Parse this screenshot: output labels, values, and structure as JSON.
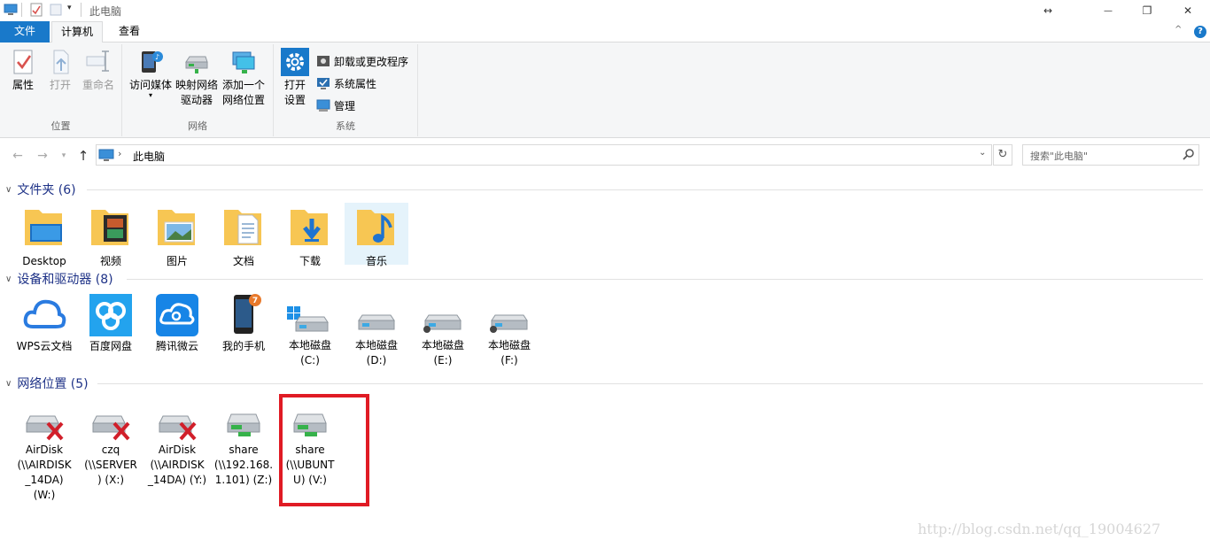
{
  "window": {
    "title": "此电脑",
    "controls": {
      "resize": "↔",
      "minimize": "—",
      "restore": "❐",
      "close": "✕"
    }
  },
  "tabs": [
    {
      "label": "文件"
    },
    {
      "label": "计算机"
    },
    {
      "label": "查看"
    }
  ],
  "help": "?",
  "collapse": "^",
  "ribbon": {
    "location": {
      "label": "位置",
      "properties": "属性",
      "open": "打开",
      "rename": "重命名"
    },
    "network": {
      "label": "网络",
      "media": "访问媒体",
      "map_drive_1": "映射网络",
      "map_drive_2": "驱动器",
      "add_location_1": "添加一个",
      "add_location_2": "网络位置"
    },
    "system": {
      "label": "系统",
      "settings_1": "打开",
      "settings_2": "设置",
      "uninstall": "卸载或更改程序",
      "sys_props": "系统属性",
      "manage": "管理"
    }
  },
  "address": {
    "path": "此电脑",
    "search_placeholder": "搜索\"此电脑\""
  },
  "sections": {
    "folders": {
      "title": "文件夹 (6)"
    },
    "devices": {
      "title": "设备和驱动器 (8)"
    },
    "network": {
      "title": "网络位置 (5)"
    }
  },
  "folders": [
    {
      "label": "Desktop"
    },
    {
      "label": "视频"
    },
    {
      "label": "图片"
    },
    {
      "label": "文档"
    },
    {
      "label": "下载"
    },
    {
      "label": "音乐"
    }
  ],
  "devices": [
    {
      "label": "WPS云文档"
    },
    {
      "label": "百度网盘"
    },
    {
      "label": "腾讯微云"
    },
    {
      "label": "我的手机"
    },
    {
      "label": "本地磁盘",
      "sub": "(C:)"
    },
    {
      "label": "本地磁盘",
      "sub": "(D:)"
    },
    {
      "label": "本地磁盘",
      "sub": "(E:)"
    },
    {
      "label": "本地磁盘",
      "sub": "(F:)"
    }
  ],
  "phone_badge": "7",
  "network_locations": [
    {
      "l1": "AirDisk",
      "l2": "(\\\\AIRDISK",
      "l3": "_14DA)",
      "l4": "(W:)"
    },
    {
      "l1": "czq",
      "l2": "(\\\\SERVER",
      "l3": ") (X:)",
      "l4": ""
    },
    {
      "l1": "AirDisk",
      "l2": "(\\\\AIRDISK",
      "l3": "_14DA) (Y:)",
      "l4": ""
    },
    {
      "l1": "share",
      "l2": "(\\\\192.168.",
      "l3": "1.101) (Z:)",
      "l4": ""
    },
    {
      "l1": "share",
      "l2": "(\\\\UBUNT",
      "l3": "U) (V:)",
      "l4": ""
    }
  ],
  "watermark": "http://blog.csdn.net/qq_19004627",
  "colors": {
    "file_tab": "#1979ca",
    "section_header": "#1e3287",
    "highlight_box": "#e01b24",
    "folder_yellow": "#f7c653"
  }
}
